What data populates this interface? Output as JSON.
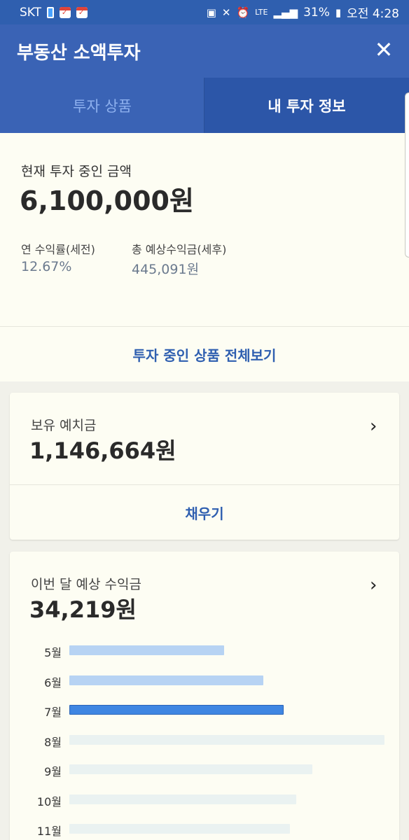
{
  "status_bar": {
    "carrier": "SKT",
    "lte": "LTE",
    "battery": "31%",
    "time": "오전 4:28"
  },
  "header": {
    "title": "부동산 소액투자",
    "close_icon": "close-icon",
    "tabs": [
      {
        "label": "투자 상품",
        "active": false
      },
      {
        "label": "내 투자 정보",
        "active": true
      }
    ]
  },
  "summary": {
    "current_label": "현재 투자 중인 금액",
    "current_amount": "6,100,000원",
    "annual_rate_label": "연 수익률(세전)",
    "annual_rate_value": "12.67%",
    "total_expected_label": "총 예상수익금(세후)",
    "total_expected_value": "445,091원",
    "view_all": "투자 중인 상품 전체보기"
  },
  "deposit_card": {
    "label": "보유 예치금",
    "amount": "1,146,664원",
    "fill_button": "채우기"
  },
  "monthly_card": {
    "label": "이번 달 예상 수익금",
    "amount": "34,219원"
  },
  "colors": {
    "primary": "#3a63b5",
    "tab_active": "#2c56a8",
    "bar_past": "#b7d3f3",
    "bar_current": "#3f86e2",
    "bar_future": "#eaf2f1"
  },
  "chart_data": {
    "type": "bar",
    "orientation": "horizontal",
    "categories": [
      "5월",
      "6월",
      "7월",
      "8월",
      "9월",
      "10월",
      "11월"
    ],
    "values": [
      0.49,
      0.615,
      0.68,
      1.0,
      0.77,
      0.72,
      0.7
    ],
    "highlight": "7월",
    "grid": false
  }
}
